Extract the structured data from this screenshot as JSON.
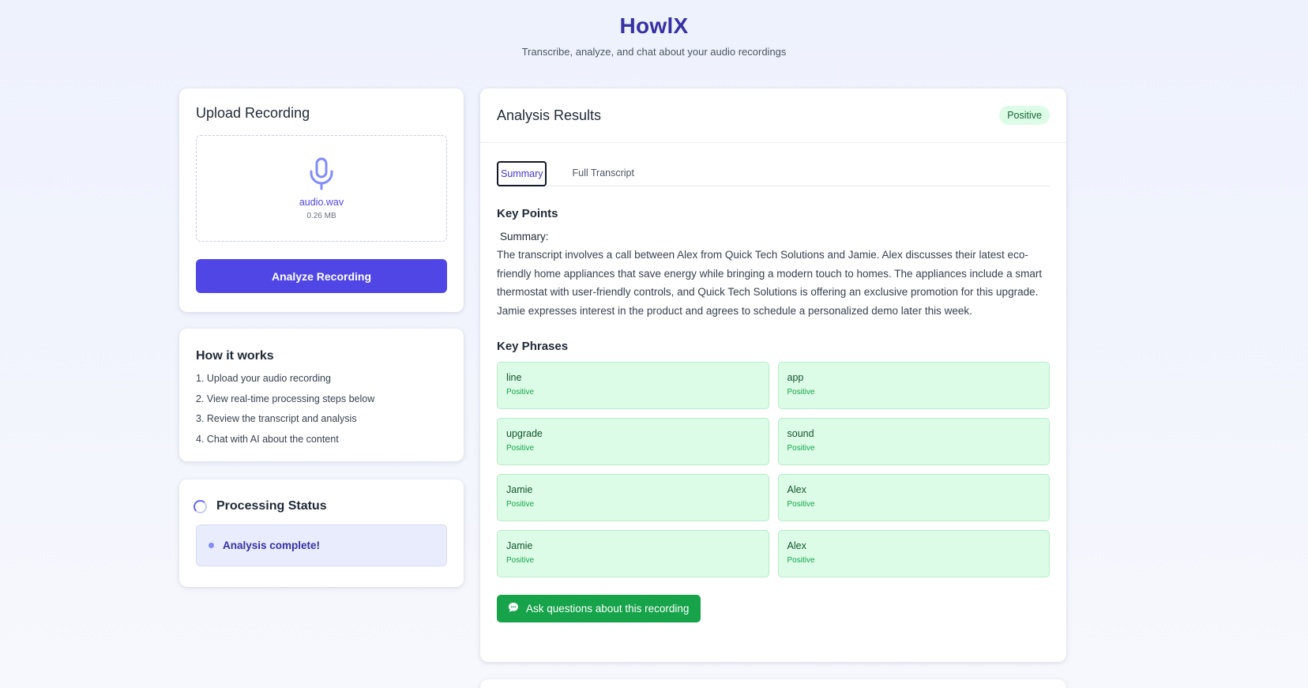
{
  "header": {
    "title": "HowlX",
    "subtitle": "Transcribe, analyze, and chat about your audio recordings"
  },
  "upload": {
    "title": "Upload Recording",
    "file_name": "audio.wav",
    "file_size": "0.26 MB",
    "analyze_label": "Analyze Recording",
    "icon": "microphone-icon"
  },
  "how_it_works": {
    "title": "How it works",
    "steps": [
      "1. Upload your audio recording",
      "2. View real-time processing steps below",
      "3. Review the transcript and analysis",
      "4. Chat with AI about the content"
    ]
  },
  "processing": {
    "title": "Processing Status",
    "message": "Analysis complete!"
  },
  "analysis": {
    "title": "Analysis Results",
    "sentiment": "Positive",
    "tabs": [
      {
        "label": "Summary",
        "active": true
      },
      {
        "label": "Full Transcript",
        "active": false
      }
    ],
    "key_points_title": "Key Points",
    "summary_label": "Summary:",
    "summary_text": "The transcript involves a call between Alex from Quick Tech Solutions and Jamie. Alex discusses their latest eco-friendly home appliances that save energy while bringing a modern touch to homes. The appliances include a smart thermostat with user-friendly controls, and Quick Tech Solutions is offering an exclusive promotion for this upgrade. Jamie expresses interest in the product and agrees to schedule a personalized demo later this week.",
    "key_phrases_title": "Key Phrases",
    "key_phrases": [
      {
        "phrase": "line",
        "sentiment": "Positive"
      },
      {
        "phrase": "app",
        "sentiment": "Positive"
      },
      {
        "phrase": "upgrade",
        "sentiment": "Positive"
      },
      {
        "phrase": "sound",
        "sentiment": "Positive"
      },
      {
        "phrase": "Jamie",
        "sentiment": "Positive"
      },
      {
        "phrase": "Alex",
        "sentiment": "Positive"
      },
      {
        "phrase": "Jamie",
        "sentiment": "Positive"
      },
      {
        "phrase": "Alex",
        "sentiment": "Positive"
      }
    ],
    "chat_button_label": "Ask questions about this recording"
  },
  "colors": {
    "brand": "#4f46e5",
    "title": "#3730a3",
    "positive_bg": "#dcfce7",
    "positive_text": "#166534",
    "chat_button": "#16a34a"
  }
}
